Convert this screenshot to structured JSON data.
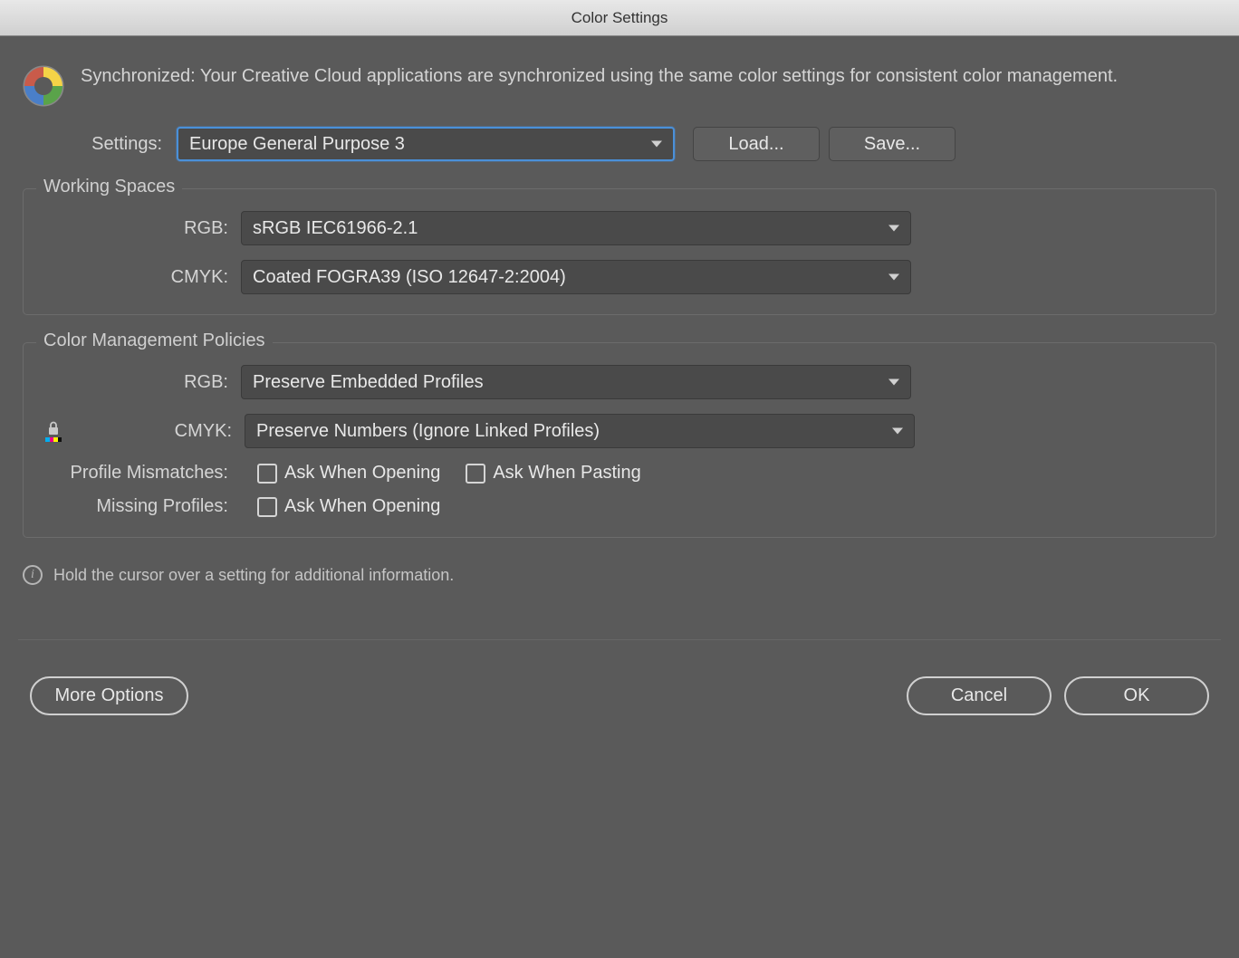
{
  "window": {
    "title": "Color Settings"
  },
  "sync": {
    "message": "Synchronized: Your Creative Cloud applications are synchronized using the same color settings for consistent color management."
  },
  "settings": {
    "label": "Settings:",
    "value": "Europe General Purpose 3",
    "load_label": "Load...",
    "save_label": "Save..."
  },
  "working_spaces": {
    "legend": "Working Spaces",
    "rgb_label": "RGB:",
    "rgb_value": "sRGB IEC61966-2.1",
    "cmyk_label": "CMYK:",
    "cmyk_value": "Coated FOGRA39 (ISO 12647-2:2004)"
  },
  "policies": {
    "legend": "Color Management Policies",
    "rgb_label": "RGB:",
    "rgb_value": "Preserve Embedded Profiles",
    "cmyk_label": "CMYK:",
    "cmyk_value": "Preserve Numbers (Ignore Linked Profiles)",
    "profile_mismatches_label": "Profile Mismatches:",
    "ask_open_label": "Ask When Opening",
    "ask_paste_label": "Ask When Pasting",
    "missing_profiles_label": "Missing Profiles:",
    "ask_open_missing_label": "Ask When Opening"
  },
  "info": {
    "text": "Hold the cursor over a setting for additional information."
  },
  "footer": {
    "more_options_label": "More Options",
    "cancel_label": "Cancel",
    "ok_label": "OK"
  }
}
